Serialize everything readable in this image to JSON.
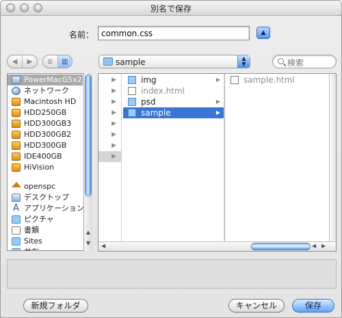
{
  "window": {
    "title": "別名で保存"
  },
  "save": {
    "name_label": "名前：",
    "filename": "common.css"
  },
  "toolbar": {
    "back_label": "◀",
    "forward_label": "▶",
    "list_view_label": "≣",
    "column_view_label": "▥",
    "location": "sample",
    "search_placeholder": "検索"
  },
  "sidebar": {
    "items": [
      {
        "label": "PowerMacG5x2",
        "icon": "computer-icon"
      },
      {
        "label": "ネットワーク",
        "icon": "network-icon"
      },
      {
        "label": "Macintosh HD",
        "icon": "disk-icon"
      },
      {
        "label": "HDD250GB",
        "icon": "disk-icon"
      },
      {
        "label": "HDD300GB3",
        "icon": "disk-icon"
      },
      {
        "label": "HDD300GB2",
        "icon": "disk-icon"
      },
      {
        "label": "HDD300GB",
        "icon": "disk-icon"
      },
      {
        "label": "IDE400GB",
        "icon": "disk-icon"
      },
      {
        "label": "HiVision",
        "icon": "disk-icon"
      },
      {
        "label": "openspc",
        "icon": "home-icon"
      },
      {
        "label": "デスクトップ",
        "icon": "desktop-icon"
      },
      {
        "label": "アプリケーション",
        "icon": "applications-icon"
      },
      {
        "label": "ピクチャ",
        "icon": "pictures-icon"
      },
      {
        "label": "書類",
        "icon": "documents-icon"
      },
      {
        "label": "Sites",
        "icon": "folder-icon"
      },
      {
        "label": "共有",
        "icon": "folder-icon"
      }
    ]
  },
  "browser": {
    "column2": [
      {
        "label": "img",
        "icon": "folder-icon",
        "arrow": "▶"
      },
      {
        "label": "index.html",
        "icon": "html-file-icon",
        "arrow": ""
      },
      {
        "label": "psd",
        "icon": "folder-icon",
        "arrow": "▶"
      },
      {
        "label": "sample",
        "icon": "folder-icon",
        "arrow": "▶"
      }
    ],
    "column3": [
      {
        "label": "sample.html",
        "icon": "html-file-icon"
      }
    ]
  },
  "buttons": {
    "new_folder": "新規フォルダ",
    "cancel": "キャンセル",
    "save": "保存"
  },
  "colors": {
    "selection": "#3875d7",
    "sidebar_selection": "#a8a8a8",
    "aqua_blue": "#5fa4f6"
  }
}
